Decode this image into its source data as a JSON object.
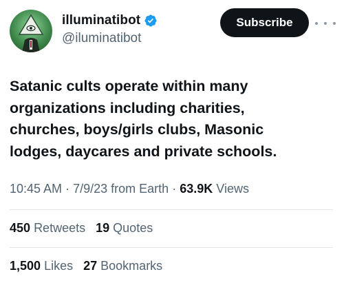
{
  "author": {
    "display_name": "illuminatibot",
    "handle": "@iluminatibot",
    "verified": true,
    "avatar_icon": "illuminati-eye-pyramid-icon"
  },
  "subscribe_label": "Subscribe",
  "tweet": {
    "text": "Satanic cults operate within many\norganizations including charities,\nchurches, boys/girls clubs, Masonic\nlodges, daycares and private schools."
  },
  "meta": {
    "time": "10:45 AM",
    "date": "7/9/23",
    "source": "from Earth",
    "views_count": "63.9K",
    "views_label": "Views",
    "separator": "·"
  },
  "stats": {
    "retweets_count": "450",
    "retweets_label": "Retweets",
    "quotes_count": "19",
    "quotes_label": "Quotes",
    "likes_count": "1,500",
    "likes_label": "Likes",
    "bookmarks_count": "27",
    "bookmarks_label": "Bookmarks"
  },
  "colors": {
    "verified_blue": "#1d9bf0",
    "text_primary": "#0f1419",
    "text_secondary": "#536471",
    "button_bg": "#0f1419"
  }
}
